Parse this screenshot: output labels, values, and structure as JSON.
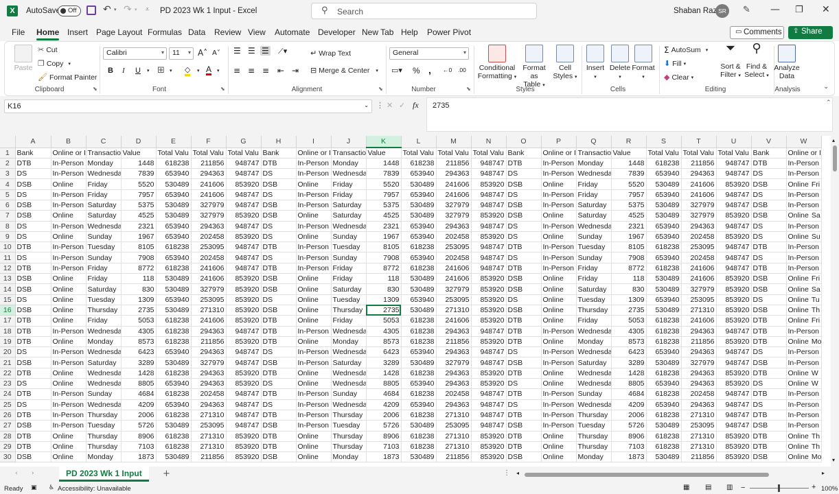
{
  "titlebar": {
    "autosave_label": "AutoSave",
    "autosave_state": "Off",
    "doc_title": "PD 2023 Wk 1 Input  -  Excel",
    "search_placeholder": "Search",
    "user_name": "Shaban Raza",
    "user_initials": "SR"
  },
  "menu": [
    "File",
    "Home",
    "Insert",
    "Page Layout",
    "Formulas",
    "Data",
    "Review",
    "View",
    "Automate",
    "Developer",
    "New Tab",
    "Help",
    "Power Pivot"
  ],
  "comments_label": "Comments",
  "share_label": "Share",
  "ribbon": {
    "clipboard": {
      "paste": "Paste",
      "cut": "Cut",
      "copy": "Copy",
      "format_painter": "Format Painter",
      "label": "Clipboard"
    },
    "font": {
      "name": "Calibri",
      "size": "11",
      "label": "Font"
    },
    "alignment": {
      "wrap_text": "Wrap Text",
      "merge_center": "Merge & Center",
      "label": "Alignment"
    },
    "number": {
      "format": "General",
      "label": "Number"
    },
    "styles": {
      "conditional_l1": "Conditional",
      "conditional_l2": "Formatting",
      "format_table_l1": "Format as",
      "format_table_l2": "Table",
      "cell_styles_l1": "Cell",
      "cell_styles_l2": "Styles",
      "label": "Styles"
    },
    "cells": {
      "insert": "Insert",
      "delete": "Delete",
      "format": "Format",
      "label": "Cells"
    },
    "editing": {
      "autosum": "AutoSum",
      "fill": "Fill",
      "clear": "Clear",
      "sort_l1": "Sort &",
      "sort_l2": "Filter",
      "find_l1": "Find &",
      "find_l2": "Select",
      "label": "Editing"
    },
    "analysis": {
      "analyze_l1": "Analyze",
      "analyze_l2": "Data",
      "label": "Analysis"
    }
  },
  "formula": {
    "name_box": "K16",
    "fx": "fx",
    "content": "2735"
  },
  "columns": [
    "A",
    "B",
    "C",
    "D",
    "E",
    "F",
    "G",
    "H",
    "I",
    "J",
    "K",
    "L",
    "M",
    "N",
    "O",
    "P",
    "Q",
    "R",
    "S",
    "T",
    "U",
    "V",
    "W"
  ],
  "header_row": [
    "Bank",
    "Online or I",
    "Transactio",
    "Value",
    "Total Valu",
    "Total Valu",
    "Total Valu",
    "Bank",
    "Online or I",
    "Transactio",
    "Value",
    "Total Valu",
    "Total Valu",
    "Total Valu",
    "Bank",
    "Online or I",
    "Transactio",
    "Value",
    "Total Valu",
    "Total Valu",
    "Total Valu",
    "Bank",
    "Online or I Tr"
  ],
  "rows": [
    [
      "DTB",
      "In-Person",
      "Monday",
      "1448",
      "618238",
      "211856",
      "948747"
    ],
    [
      "DS",
      "In-Person",
      "Wednesda",
      "7839",
      "653940",
      "294363",
      "948747"
    ],
    [
      "DSB",
      "Online",
      "Friday",
      "5520",
      "530489",
      "241606",
      "853920"
    ],
    [
      "DS",
      "In-Person",
      "Friday",
      "7957",
      "653940",
      "241606",
      "948747"
    ],
    [
      "DSB",
      "In-Person",
      "Saturday",
      "5375",
      "530489",
      "327979",
      "948747"
    ],
    [
      "DSB",
      "Online",
      "Saturday",
      "4525",
      "530489",
      "327979",
      "853920"
    ],
    [
      "DS",
      "In-Person",
      "Wednesda",
      "2321",
      "653940",
      "294363",
      "948747"
    ],
    [
      "DS",
      "Online",
      "Sunday",
      "1967",
      "653940",
      "202458",
      "853920"
    ],
    [
      "DTB",
      "In-Person",
      "Tuesday",
      "8105",
      "618238",
      "253095",
      "948747"
    ],
    [
      "DS",
      "In-Person",
      "Sunday",
      "7908",
      "653940",
      "202458",
      "948747"
    ],
    [
      "DTB",
      "In-Person",
      "Friday",
      "8772",
      "618238",
      "241606",
      "948747"
    ],
    [
      "DSB",
      "Online",
      "Friday",
      "118",
      "530489",
      "241606",
      "853920"
    ],
    [
      "DSB",
      "Online",
      "Saturday",
      "830",
      "530489",
      "327979",
      "853920"
    ],
    [
      "DS",
      "Online",
      "Tuesday",
      "1309",
      "653940",
      "253095",
      "853920"
    ],
    [
      "DSB",
      "Online",
      "Thursday",
      "2735",
      "530489",
      "271310",
      "853920"
    ],
    [
      "DTB",
      "Online",
      "Friday",
      "5053",
      "618238",
      "241606",
      "853920"
    ],
    [
      "DTB",
      "In-Person",
      "Wednesda",
      "4305",
      "618238",
      "294363",
      "948747"
    ],
    [
      "DTB",
      "Online",
      "Monday",
      "8573",
      "618238",
      "211856",
      "853920"
    ],
    [
      "DS",
      "In-Person",
      "Wednesda",
      "6423",
      "653940",
      "294363",
      "948747"
    ],
    [
      "DSB",
      "In-Person",
      "Saturday",
      "3289",
      "530489",
      "327979",
      "948747"
    ],
    [
      "DTB",
      "Online",
      "Wednesda",
      "1428",
      "618238",
      "294363",
      "853920"
    ],
    [
      "DS",
      "Online",
      "Wednesda",
      "8805",
      "653940",
      "294363",
      "853920"
    ],
    [
      "DTB",
      "In-Person",
      "Sunday",
      "4684",
      "618238",
      "202458",
      "948747"
    ],
    [
      "DS",
      "In-Person",
      "Wednesda",
      "4209",
      "653940",
      "294363",
      "948747"
    ],
    [
      "DTB",
      "In-Person",
      "Thursday",
      "2006",
      "618238",
      "271310",
      "948747"
    ],
    [
      "DSB",
      "In-Person",
      "Tuesday",
      "5726",
      "530489",
      "253095",
      "948747"
    ],
    [
      "DTB",
      "Online",
      "Thursday",
      "8906",
      "618238",
      "271310",
      "853920"
    ],
    [
      "DTB",
      "Online",
      "Thursday",
      "7103",
      "618238",
      "271310",
      "853920"
    ],
    [
      "DSB",
      "Online",
      "Monday",
      "1873",
      "530489",
      "211856",
      "853920"
    ]
  ],
  "last_col_abbrev": {
    "Monday": "Mo",
    "Wednesda": "W",
    "Friday": "Fri",
    "Saturday": "Sa",
    "Sunday": "Su",
    "Tuesday": "Tu",
    "Thursday": "Th"
  },
  "sheet_tab": "PD 2023 Wk 1 Input",
  "status": {
    "ready": "Ready",
    "accessibility": "Accessibility: Unavailable",
    "zoom": "100%"
  }
}
